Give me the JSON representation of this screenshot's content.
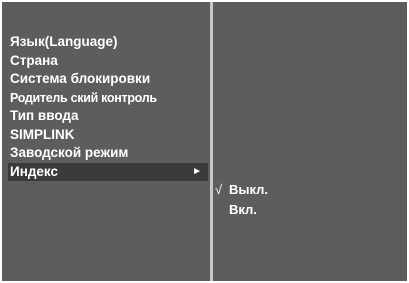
{
  "menu": {
    "items": [
      {
        "label": "Язык(Language)"
      },
      {
        "label": "Страна"
      },
      {
        "label": "Система блокировки"
      },
      {
        "label": "Родитель ский контроль"
      },
      {
        "label": "Тип ввода"
      },
      {
        "label": "SIMPLINK"
      },
      {
        "label": "Заводской режим"
      },
      {
        "label": "Индекс"
      }
    ],
    "selected_index": 7,
    "submenu_arrow": "►"
  },
  "submenu": {
    "check_mark": "√",
    "options": [
      {
        "label": "Выкл.",
        "checked": true
      },
      {
        "label": "Вкл.",
        "checked": false
      }
    ]
  },
  "colors": {
    "panel_bg": "#5d5d5d",
    "highlight_bg": "#3a3a3a",
    "text": "#ffffff"
  },
  "icons": {
    "submenu_arrow": "arrow-right-icon",
    "check": "check-icon"
  }
}
